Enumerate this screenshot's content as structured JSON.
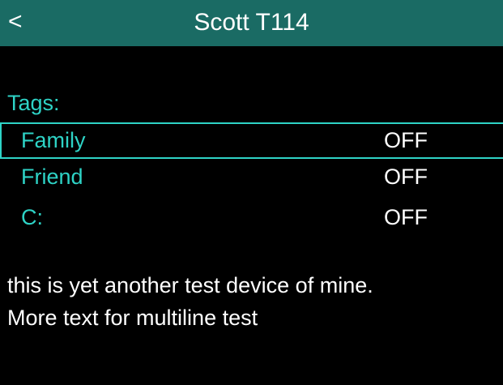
{
  "header": {
    "back_label": "<",
    "title": "Scott T114"
  },
  "tags": {
    "label": "Tags:",
    "items": [
      {
        "name": "Family",
        "value": "OFF"
      },
      {
        "name": "Friend",
        "value": "OFF"
      },
      {
        "name": "C:",
        "value": "OFF"
      }
    ]
  },
  "description": {
    "line1": "this is yet another test device of mine.",
    "line2": "More text for multiline test"
  },
  "colors": {
    "header_bg": "#1a6b64",
    "accent": "#2ed3c6",
    "background": "#000000"
  }
}
